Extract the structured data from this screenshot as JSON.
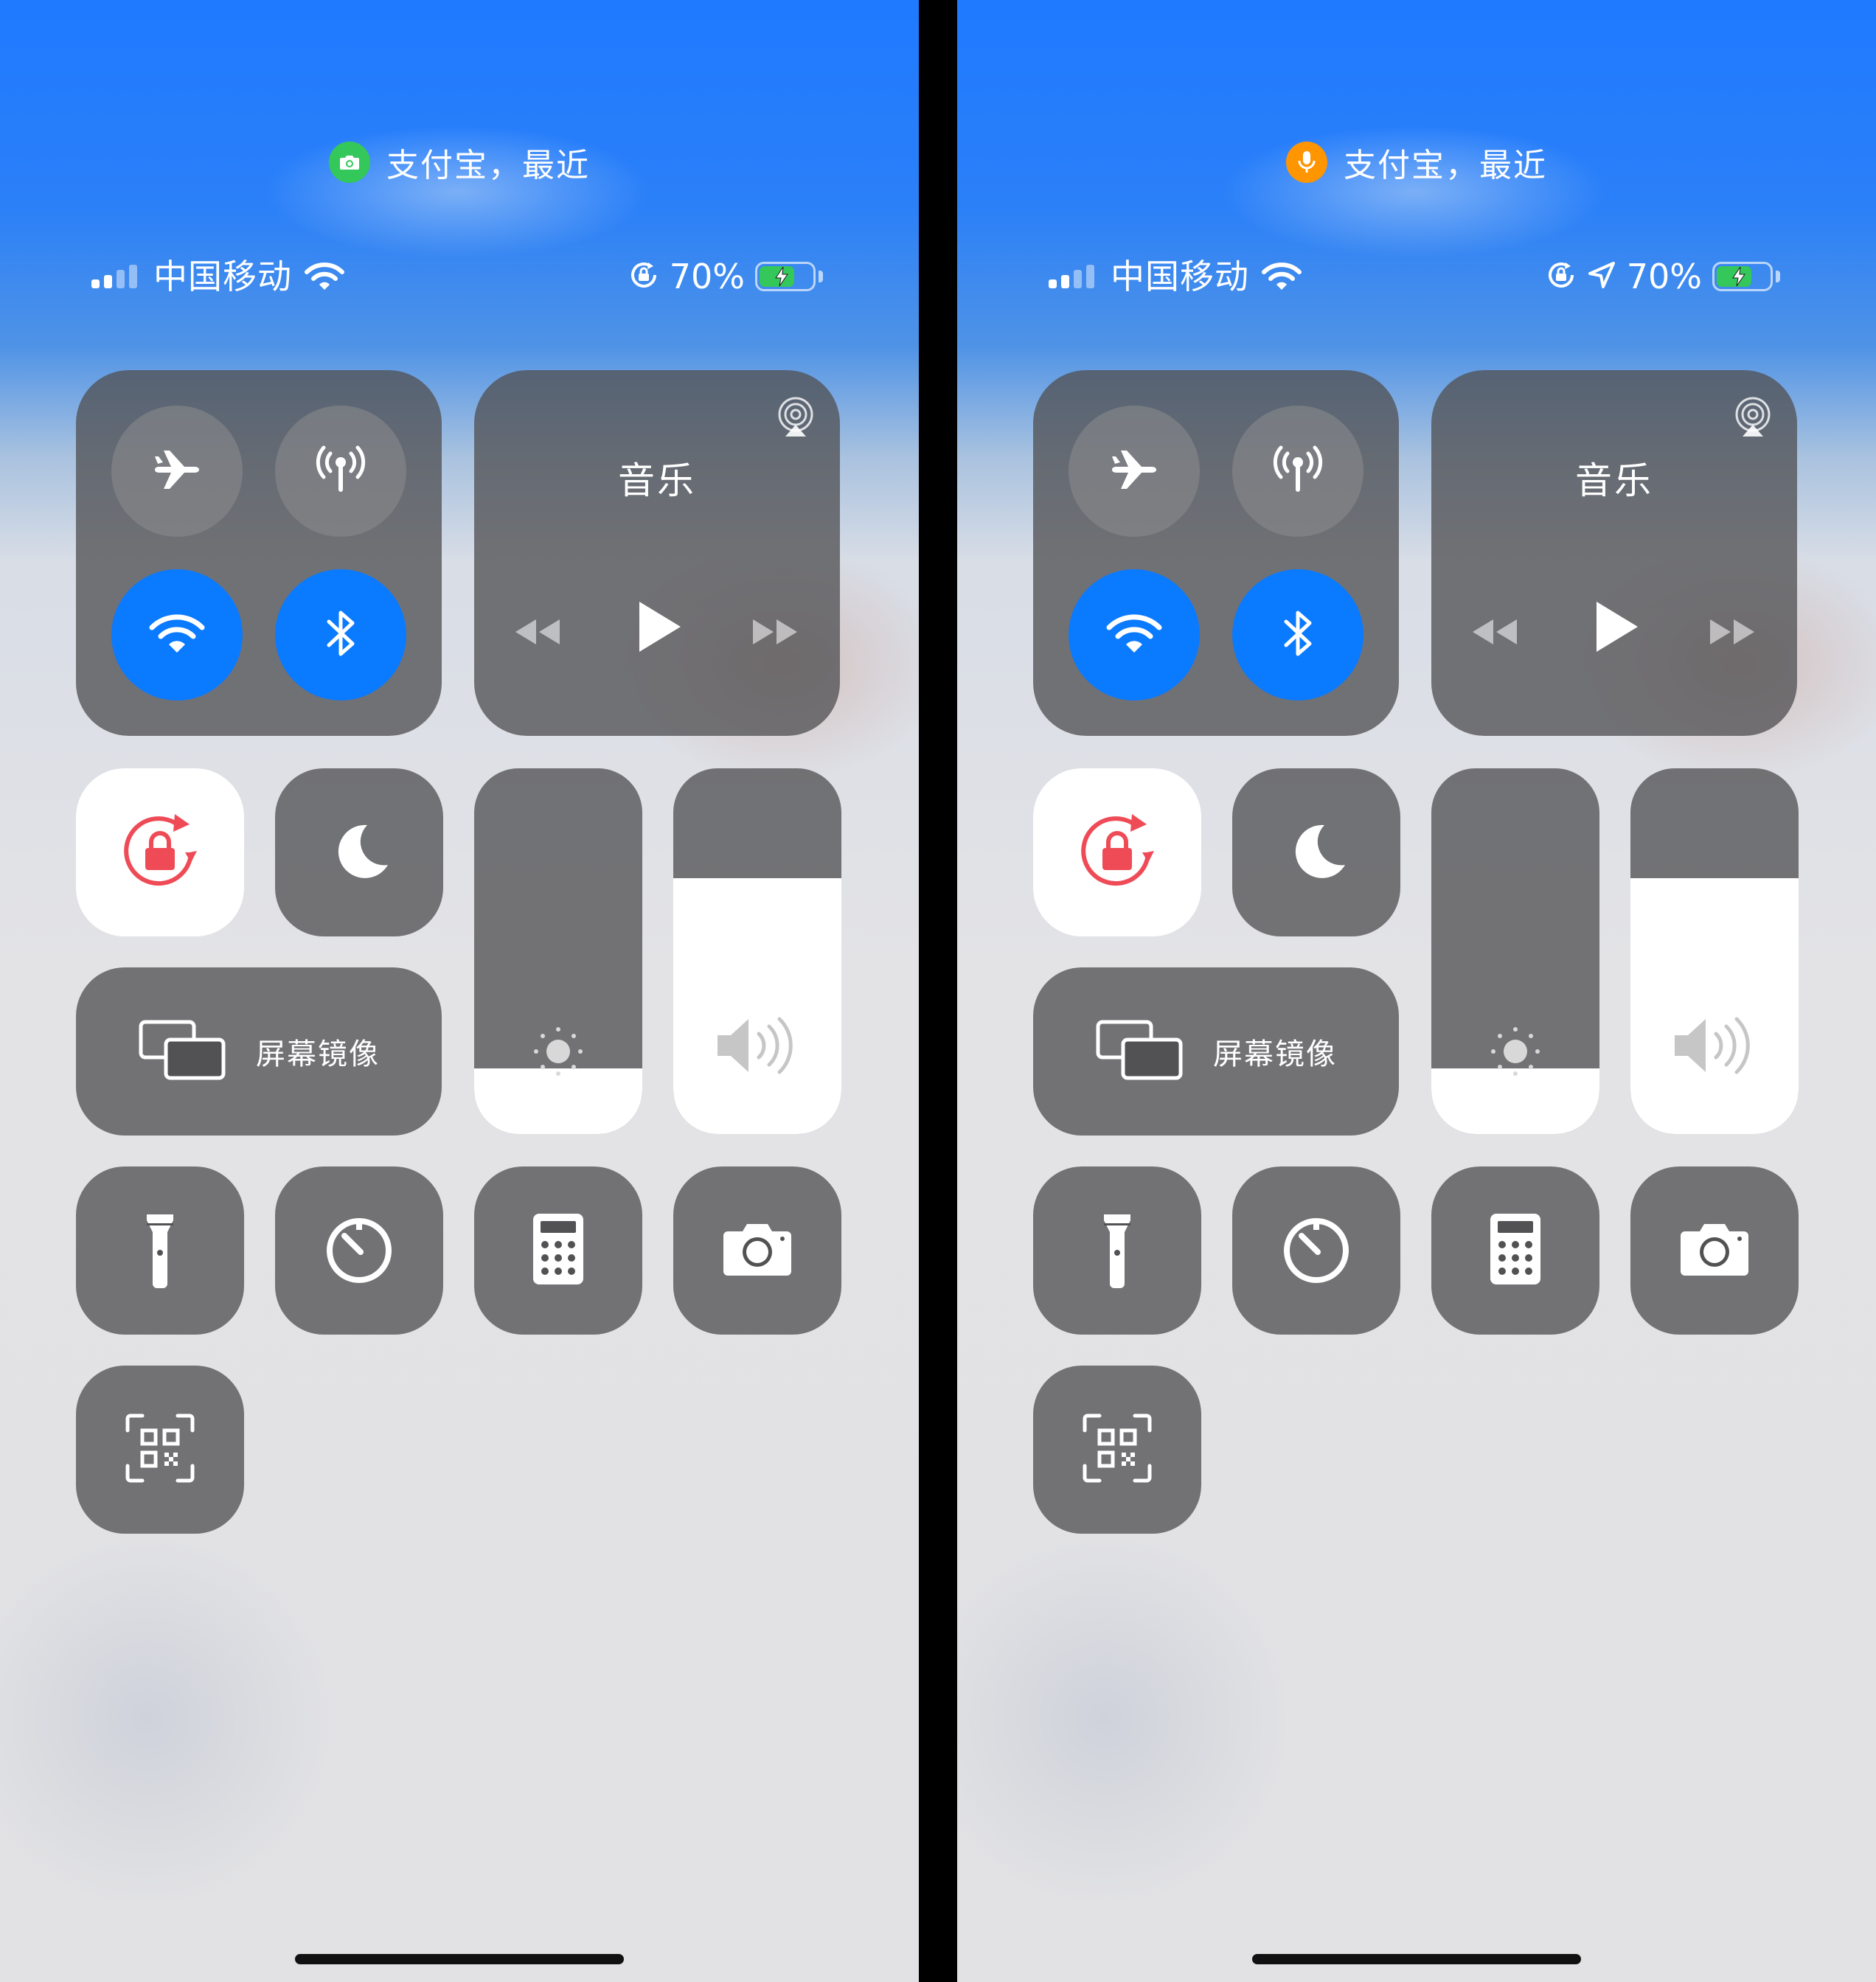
{
  "screens": [
    {
      "id": "left",
      "privacy_indicator": {
        "icon": "camera-icon",
        "color": "#34c759",
        "text": "支付宝，最近"
      },
      "status_bar": {
        "carrier": "中国移动",
        "battery_percent": "70%",
        "icons": [
          "signal-icon",
          "wifi-icon",
          "rotation-lock-icon",
          "battery-icon"
        ],
        "battery_level": 0.7,
        "battery_color": "#34c759"
      },
      "connectivity": {
        "airplane_mode": false,
        "cellular_data": false,
        "wifi": true,
        "bluetooth": true,
        "active_color": "#0a7aff"
      },
      "music": {
        "title": "音乐",
        "controls": [
          "airplay-icon",
          "rewind-icon",
          "play-icon",
          "fast-forward-icon"
        ]
      },
      "rotation_lock": {
        "enabled": true,
        "color": "#ef4b57"
      },
      "do_not_disturb": {
        "enabled": false
      },
      "screen_mirroring": {
        "label": "屏幕镜像"
      },
      "brightness_level": 0.18,
      "volume_level": 0.7,
      "shortcuts": [
        "flashlight-icon",
        "timer-icon",
        "calculator-icon",
        "camera-icon",
        "qr-scanner-icon"
      ]
    },
    {
      "id": "right",
      "privacy_indicator": {
        "icon": "microphone-icon",
        "color": "#ff9500",
        "text": "支付宝，最近"
      },
      "status_bar": {
        "carrier": "中国移动",
        "battery_percent": "70%",
        "icons": [
          "signal-icon",
          "wifi-icon",
          "rotation-lock-icon",
          "location-icon",
          "battery-icon"
        ],
        "battery_level": 0.7,
        "battery_color": "#34c759"
      },
      "connectivity": {
        "airplane_mode": false,
        "cellular_data": false,
        "wifi": true,
        "bluetooth": true,
        "active_color": "#0a7aff"
      },
      "music": {
        "title": "音乐",
        "controls": [
          "airplay-icon",
          "rewind-icon",
          "play-icon",
          "fast-forward-icon"
        ]
      },
      "rotation_lock": {
        "enabled": true,
        "color": "#ef4b57"
      },
      "do_not_disturb": {
        "enabled": false
      },
      "screen_mirroring": {
        "label": "屏幕镜像"
      },
      "brightness_level": 0.18,
      "volume_level": 0.7,
      "shortcuts": [
        "flashlight-icon",
        "timer-icon",
        "calculator-icon",
        "camera-icon",
        "qr-scanner-icon"
      ]
    }
  ]
}
